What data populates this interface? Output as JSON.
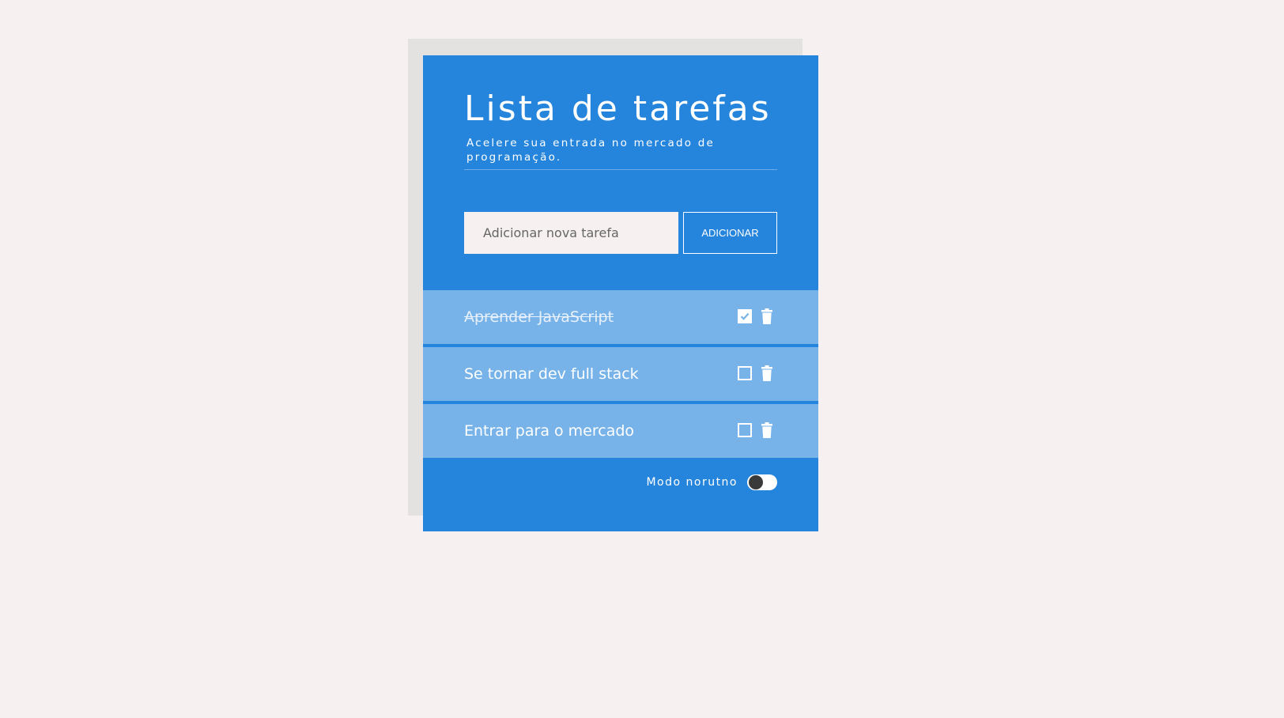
{
  "header": {
    "title": "Lista de tarefas",
    "subtitle": "Acelere sua entrada no mercado de programação."
  },
  "add_form": {
    "input_placeholder": "Adicionar nova tarefa",
    "button_label": "ADICIONAR"
  },
  "tasks": [
    {
      "text": "Aprender JavaScript",
      "done": true
    },
    {
      "text": "Se tornar dev full stack",
      "done": false
    },
    {
      "text": "Entrar para o mercado",
      "done": false
    }
  ],
  "footer": {
    "night_mode_label": "Modo norutno",
    "night_mode_on": false
  },
  "colors": {
    "background": "#f6f0f0",
    "card": "#2584dc",
    "task_row": "#77b3e9",
    "shadow": "#e4e2e1"
  },
  "icons": {
    "checkbox_checked": "checkbox-checked-icon",
    "checkbox_empty": "checkbox-empty-icon",
    "trash": "trash-icon"
  }
}
